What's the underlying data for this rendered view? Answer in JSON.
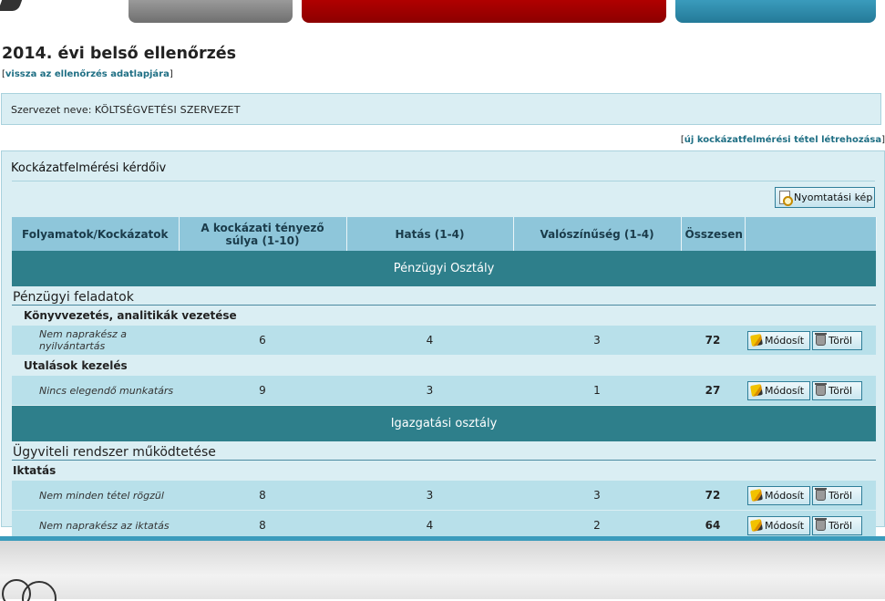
{
  "header": {
    "title": "2014. évi belső ellenőrzés",
    "back_link": "vissza az ellenőrzés adatlapjára"
  },
  "organization": {
    "label": "Szervezet neve:",
    "value": "KÖLTSÉGVETÉSI SZERVEZET"
  },
  "new_item_link": "új kockázatfelmérési tétel létrehozása",
  "panel": {
    "title": "Kockázatfelmérési kérdőiv",
    "print_button": "Nyomtatási kép"
  },
  "columns": [
    "Folyamatok/Kockázatok",
    "A kockázati tényező súlya (1-10)",
    "Hatás (1-4)",
    "Valószínűség (1-4)",
    "Összesen",
    ""
  ],
  "actions": {
    "edit": "Módosít",
    "delete": "Töröl"
  },
  "departments": [
    {
      "name": "Pénzügyi Osztály",
      "group": "Pénzügyi feladatok",
      "subs": [
        {
          "name": "Könyvvezetés, analitikák vezetése",
          "items": [
            {
              "risk": "Nem naprakész a nyilvántartás",
              "weight": "6",
              "impact": "4",
              "prob": "3",
              "total": "72"
            }
          ]
        },
        {
          "name": "Utalások kezelés",
          "items": [
            {
              "risk": "Nincs elegendő munkatárs",
              "weight": "9",
              "impact": "3",
              "prob": "1",
              "total": "27"
            }
          ]
        }
      ]
    },
    {
      "name": "Igazgatási osztály",
      "group": "Ügyviteli rendszer működtetése",
      "subs": [
        {
          "name": "Iktatás",
          "items": [
            {
              "risk": "Nem minden tétel rögzül",
              "weight": "8",
              "impact": "3",
              "prob": "3",
              "total": "72"
            },
            {
              "risk": "Nem naprakész az iktatás",
              "weight": "8",
              "impact": "4",
              "prob": "2",
              "total": "64"
            }
          ]
        }
      ]
    }
  ],
  "colors": {
    "accent_red": "#a00000",
    "accent_blue": "#2e8fb0",
    "department_bar": "#2e7f8b",
    "header_row": "#8ec6da",
    "panel_bg": "#daeef3"
  }
}
